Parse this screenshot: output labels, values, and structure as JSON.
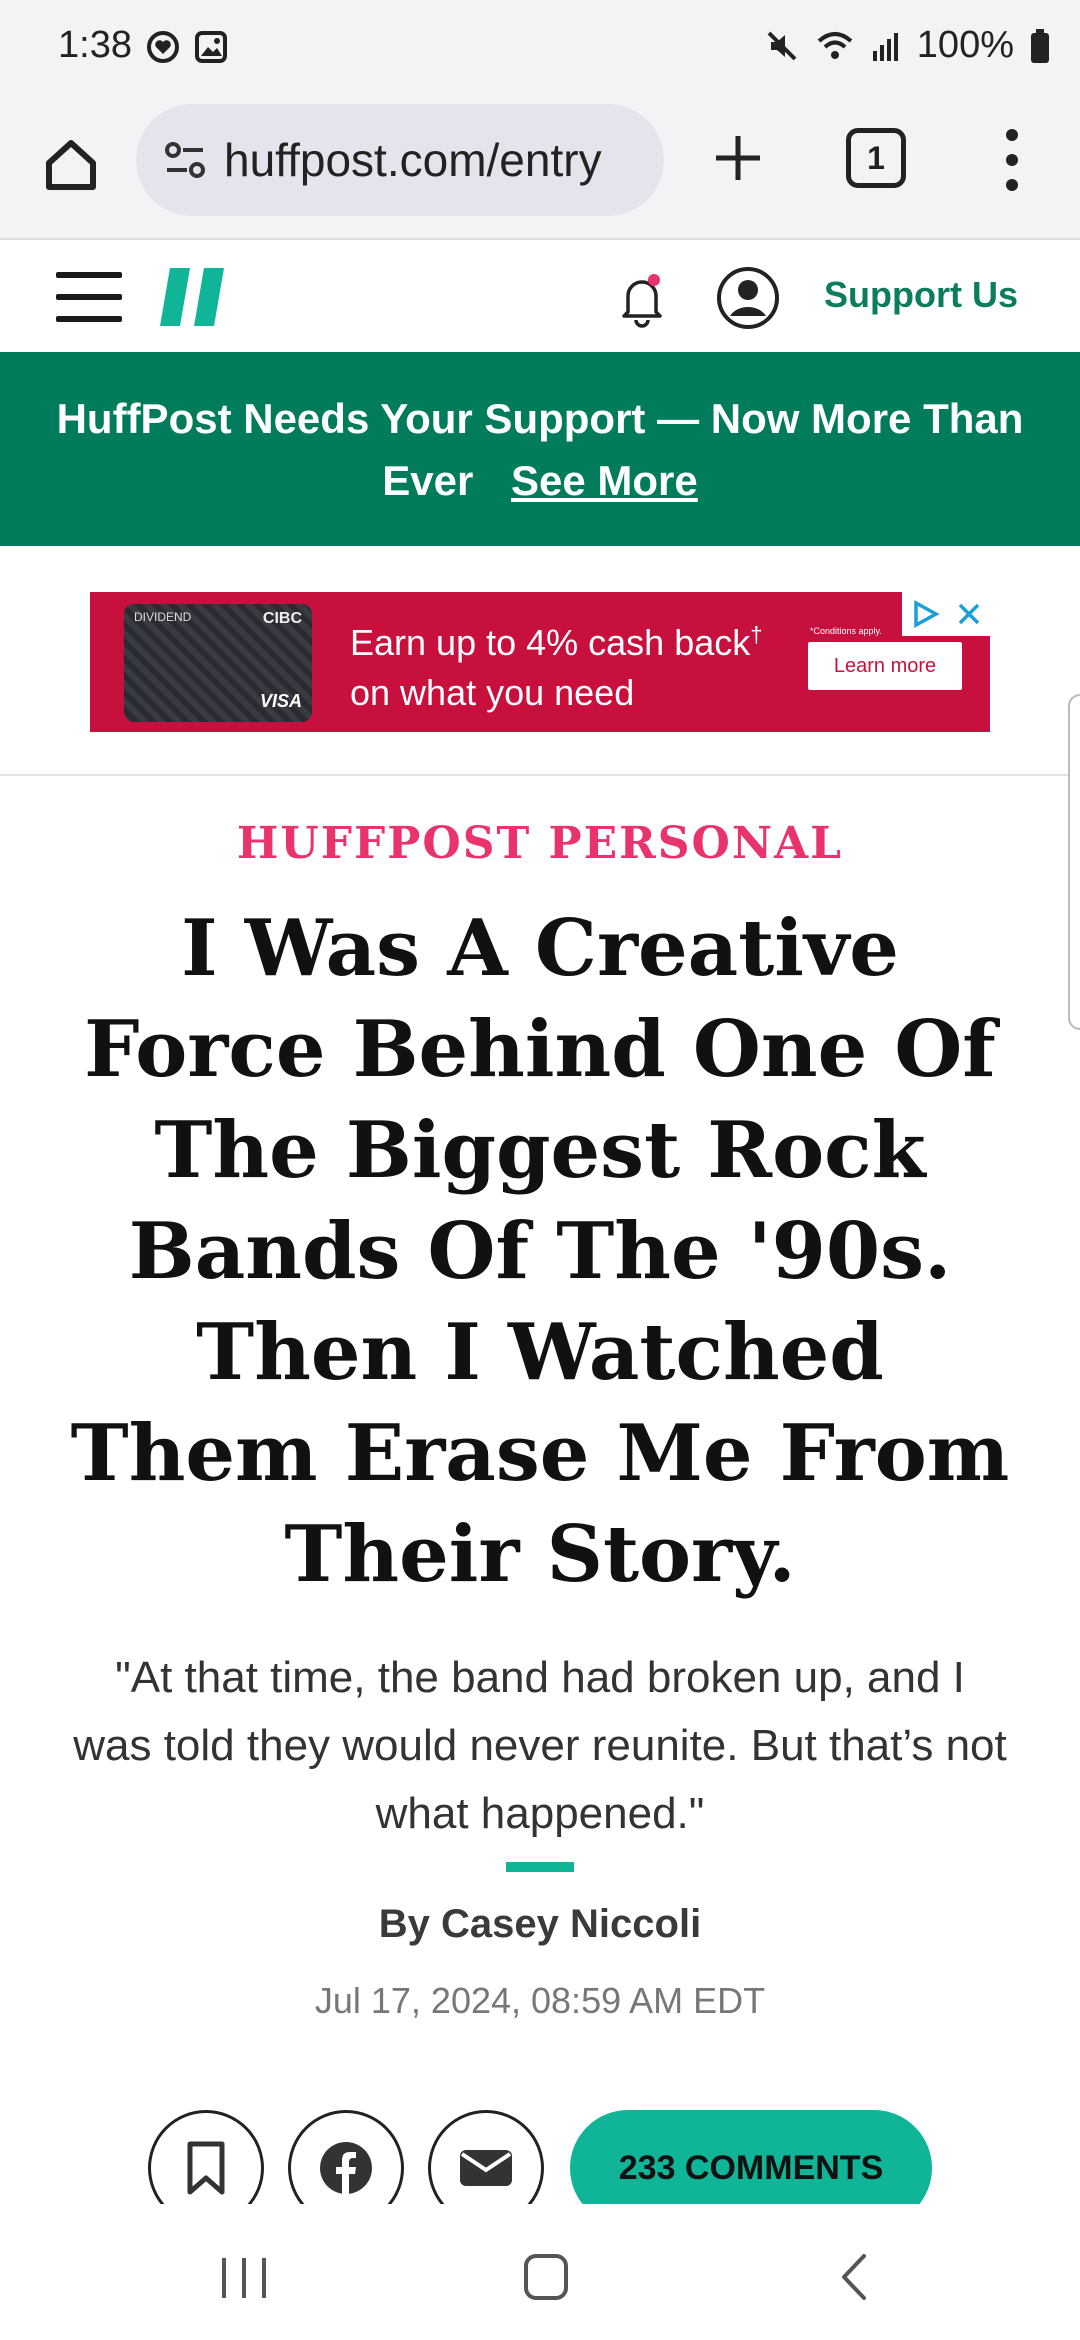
{
  "status_bar": {
    "time": "1:38",
    "battery": "100%"
  },
  "browser": {
    "url": "huffpost.com/entry",
    "tab_count": "1"
  },
  "site_header": {
    "support_label": "Support Us"
  },
  "banner": {
    "text": "HuffPost Needs Your Support — Now More Than Ever",
    "link": "See More"
  },
  "ad": {
    "card_brand": "CIBC",
    "card_name": "DIVIDEND",
    "card_network": "VISA",
    "headline": "Earn up to 4% cash back",
    "headline_mark": "†",
    "subline": "on what you need",
    "conditions": "*Conditions apply.",
    "cta": "Learn more"
  },
  "article": {
    "kicker": "HUFFPOST PERSONAL",
    "headline": "I Was A Creative Force Behind One Of The Biggest Rock Bands Of The '90s. Then I Watched Them Erase Me From Their Story.",
    "subhead": "\"At that time, the band had broken up, and I was told they would never reunite. But that’s not what happened.\"",
    "byline": "By Casey Niccoli",
    "date": "Jul 17, 2024, 08:59 AM EDT",
    "comments_label": "233 COMMENTS"
  },
  "colors": {
    "brand_green": "#007c5c",
    "accent_teal": "#10b496",
    "kicker_pink": "#e8336c",
    "ad_red": "#c8103e"
  }
}
